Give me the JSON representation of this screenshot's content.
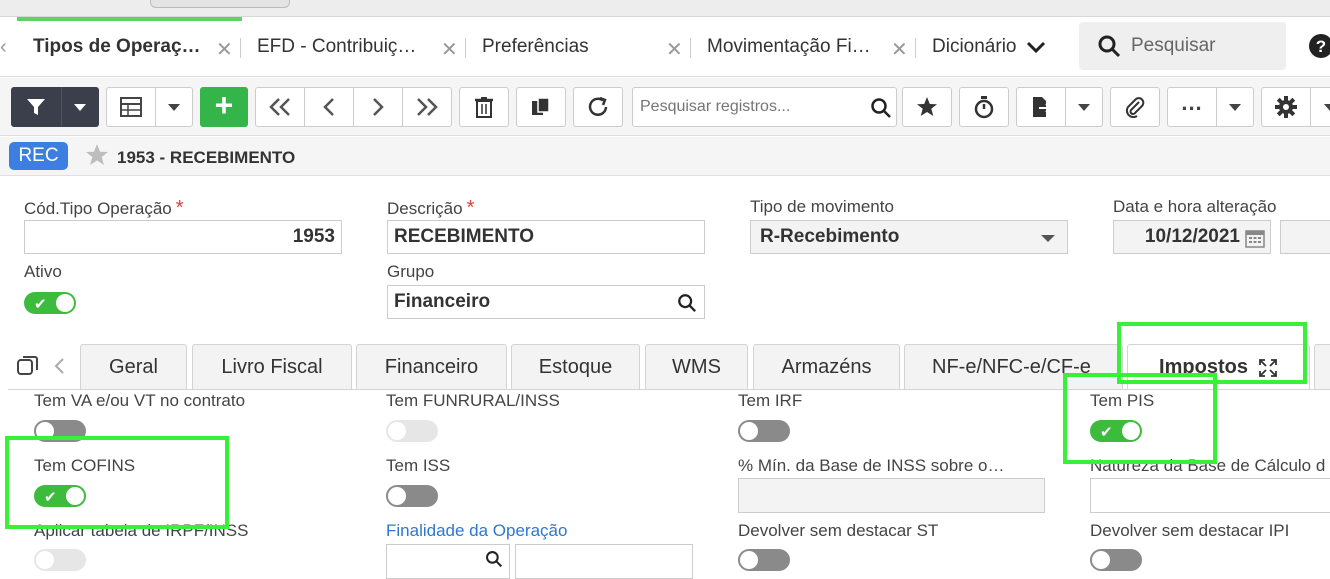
{
  "window_tabs": [
    {
      "label": "Tipos de Operaç…",
      "active": true
    },
    {
      "label": "EFD - Contribuiç…",
      "active": false
    },
    {
      "label": "Preferências",
      "active": false
    },
    {
      "label": "Movimentação Fi…",
      "active": false
    },
    {
      "label": "Dicionário",
      "active": false
    }
  ],
  "global_search": {
    "placeholder": "Pesquisar"
  },
  "toolbar": {
    "search_placeholder": "Pesquisar registros...",
    "add_label": "+"
  },
  "record": {
    "badge": "REC",
    "title": "1953 - RECEBIMENTO"
  },
  "form": {
    "cod_label": "Cód.Tipo Operação",
    "cod_value": "1953",
    "descricao_label": "Descrição",
    "descricao_value": "RECEBIMENTO",
    "tipo_mov_label": "Tipo de movimento",
    "tipo_mov_value": "R-Recebimento",
    "data_label": "Data e hora alteração",
    "data_value": "10/12/2021",
    "ativo_label": "Ativo",
    "ativo_on": true,
    "grupo_label": "Grupo",
    "grupo_value": "Financeiro",
    "required_mark": "*"
  },
  "detail_tabs": [
    {
      "label": "Geral"
    },
    {
      "label": "Livro Fiscal"
    },
    {
      "label": "Financeiro"
    },
    {
      "label": "Estoque"
    },
    {
      "label": "WMS"
    },
    {
      "label": "Armazéns"
    },
    {
      "label": "NF-e/NFC-e/CF-e"
    },
    {
      "label": "Impostos",
      "active": true
    }
  ],
  "impostos": {
    "va_vt_label": "Tem VA e/ou VT no contrato",
    "funrural_label": "Tem FUNRURAL/INSS",
    "irf_label": "Tem IRF",
    "pis_label": "Tem PIS",
    "cofins_label": "Tem COFINS",
    "iss_label": "Tem ISS",
    "min_base_inss_label": "% Mín. da Base de INSS sobre o…",
    "natureza_label": "Natureza da Base de Cálculo d",
    "irpf_label": "Aplicar tabela de IRPF/INSS",
    "finalidade_label": "Finalidade da Operação",
    "dev_st_label": "Devolver sem destacar ST",
    "dev_ipi_label": "Devolver sem destacar IPI"
  },
  "colors": {
    "accent_green": "#3dbb3d",
    "highlight": "#37f037",
    "badge_blue": "#3d7fe0"
  }
}
